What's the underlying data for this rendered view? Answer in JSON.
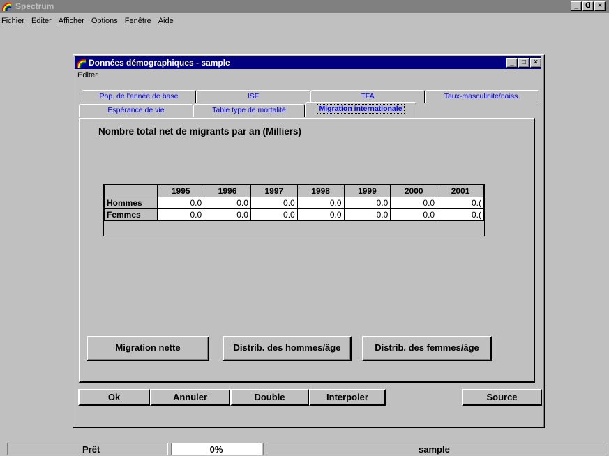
{
  "app": {
    "title": "Spectrum",
    "menu": [
      "Fichier",
      "Editer",
      "Afficher",
      "Options",
      "Fenêtre",
      "Aide"
    ],
    "window_controls": [
      "_",
      "ᗡ",
      "×"
    ]
  },
  "dialog": {
    "title": "Données démographiques - sample",
    "menu": "Editer",
    "tabs_back_row": [
      "Pop. de l'année de base",
      "ISF",
      "TFA",
      "Taux-masculinite/naiss."
    ],
    "tabs_front_row": [
      "Espérance de vie",
      "Table type de mortalité",
      "Migration internationale"
    ],
    "active_tab": "Migration internationale",
    "panel_title": "Nombre total net de migrants par an (Milliers)",
    "grid": {
      "columns": [
        "1995",
        "1996",
        "1997",
        "1998",
        "1999",
        "2000",
        "2001"
      ],
      "rows": [
        {
          "label": "Hommes",
          "values": [
            "0.0",
            "0.0",
            "0.0",
            "0.0",
            "0.0",
            "0.0",
            "0.("
          ]
        },
        {
          "label": "Femmes",
          "values": [
            "0.0",
            "0.0",
            "0.0",
            "0.0",
            "0.0",
            "0.0",
            "0.("
          ]
        }
      ]
    },
    "panel_buttons": [
      "Migration nette",
      "Distrib. des hommes/âge",
      "Distrib. des femmes/âge"
    ],
    "bottom_buttons": [
      "Ok",
      "Annuler",
      "Double",
      "Interpoler",
      "Source"
    ]
  },
  "status": {
    "state": "Prêt",
    "progress": "0%",
    "document": "sample"
  },
  "colors": {
    "face": "#c0c0c0",
    "active_title": "#000080",
    "inactive_title": "#808080",
    "tab_text": "#0000ff"
  }
}
